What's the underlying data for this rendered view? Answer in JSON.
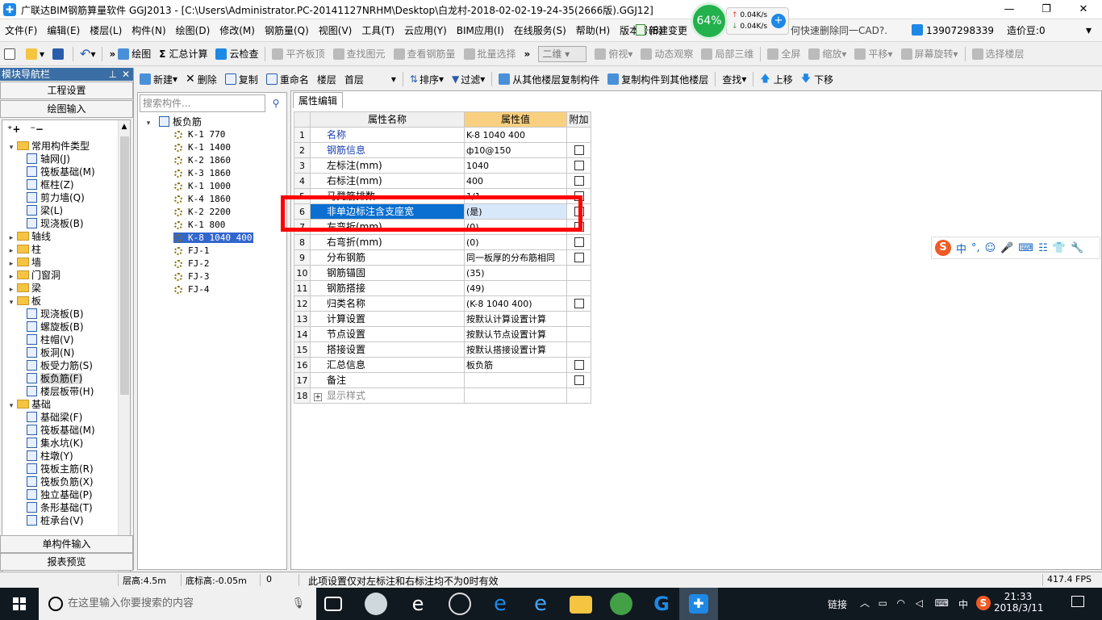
{
  "window": {
    "title": "广联达BIM钢筋算量软件 GGJ2013 - [C:\\Users\\Administrator.PC-20141127NRHM\\Desktop\\白龙村-2018-02-02-19-24-35(2666版).GGJ12]",
    "minimize": "—",
    "restore": "❐",
    "close": "✕"
  },
  "network": {
    "percent": "64%",
    "up": "0.04K/s",
    "down": "0.04K/s"
  },
  "menu": {
    "items": [
      "文件(F)",
      "编辑(E)",
      "楼层(L)",
      "构件(N)",
      "绘图(D)",
      "修改(M)",
      "钢筋量(Q)",
      "视图(V)",
      "工具(T)",
      "云应用(Y)",
      "BIM应用(I)",
      "在线服务(S)",
      "帮助(H)",
      "版本号(B)"
    ],
    "new_change": "新建变更",
    "tip": "何快速删除同一CAD?.",
    "phone": "13907298339",
    "cost_bean": "造价豆:0"
  },
  "toolbar": {
    "draw": "绘图",
    "sum_calc": "汇总计算",
    "cloud_check": "云检查",
    "flush_slab": "平齐板顶",
    "find_element": "查找图元",
    "view_rebar": "查看钢筋量",
    "batch_select": "批量选择",
    "view_mode": "二维",
    "top_view": "俯视",
    "dynamic_view": "动态观察",
    "local_3d": "局部三维",
    "fullscreen": "全屏",
    "zoom": "缩放",
    "pan": "平移",
    "rotate": "屏幕旋转",
    "select_floor": "选择楼层"
  },
  "toolbar2": {
    "new": "新建",
    "delete": "删除",
    "copy": "复制",
    "rename": "重命名",
    "floor_label": "楼层",
    "floor_value": "首层",
    "sort": "排序",
    "filter": "过滤",
    "copy_from": "从其他楼层复制构件",
    "copy_to": "复制构件到其他楼层",
    "find": "查找",
    "move_up": "上移",
    "move_down": "下移"
  },
  "nav": {
    "header": "模块导航栏",
    "project_settings": "工程设置",
    "drawing_input": "绘图输入",
    "single_input": "单构件输入",
    "report_preview": "报表预览",
    "tree": [
      {
        "level": 0,
        "exp": "▾",
        "folder": true,
        "label": "常用构件类型"
      },
      {
        "level": 1,
        "label": "轴网(J)"
      },
      {
        "level": 1,
        "label": "筏板基础(M)"
      },
      {
        "level": 1,
        "label": "框柱(Z)"
      },
      {
        "level": 1,
        "label": "剪力墙(Q)"
      },
      {
        "level": 1,
        "label": "梁(L)"
      },
      {
        "level": 1,
        "label": "现浇板(B)"
      },
      {
        "level": 0,
        "exp": "▸",
        "folder": true,
        "label": "轴线"
      },
      {
        "level": 0,
        "exp": "▸",
        "folder": true,
        "label": "柱"
      },
      {
        "level": 0,
        "exp": "▸",
        "folder": true,
        "label": "墙"
      },
      {
        "level": 0,
        "exp": "▸",
        "folder": true,
        "label": "门窗洞"
      },
      {
        "level": 0,
        "exp": "▸",
        "folder": true,
        "label": "梁"
      },
      {
        "level": 0,
        "exp": "▾",
        "folder": true,
        "label": "板"
      },
      {
        "level": 1,
        "label": "现浇板(B)"
      },
      {
        "level": 1,
        "label": "螺旋板(B)"
      },
      {
        "level": 1,
        "label": "柱帽(V)"
      },
      {
        "level": 1,
        "label": "板洞(N)"
      },
      {
        "level": 1,
        "label": "板受力筋(S)"
      },
      {
        "level": 1,
        "label": "板负筋(F)",
        "sel": true
      },
      {
        "level": 1,
        "label": "楼层板带(H)"
      },
      {
        "level": 0,
        "exp": "▾",
        "folder": true,
        "label": "基础"
      },
      {
        "level": 1,
        "label": "基础梁(F)"
      },
      {
        "level": 1,
        "label": "筏板基础(M)"
      },
      {
        "level": 1,
        "label": "集水坑(K)"
      },
      {
        "level": 1,
        "label": "柱墩(Y)"
      },
      {
        "level": 1,
        "label": "筏板主筋(R)"
      },
      {
        "level": 1,
        "label": "筏板负筋(X)"
      },
      {
        "level": 1,
        "label": "独立基础(P)"
      },
      {
        "level": 1,
        "label": "条形基础(T)"
      },
      {
        "level": 1,
        "label": "桩承台(V)"
      }
    ]
  },
  "components": {
    "search_placeholder": "搜索构件...",
    "root": "板负筋",
    "items": [
      {
        "label": "K-1 770"
      },
      {
        "label": "K-1 1400"
      },
      {
        "label": "K-2 1860"
      },
      {
        "label": "K-3 1860"
      },
      {
        "label": "K-1 1000"
      },
      {
        "label": "K-4 1860"
      },
      {
        "label": "K-2 2200"
      },
      {
        "label": "K-1 800"
      },
      {
        "label": "K-8 1040 400",
        "sel": true
      },
      {
        "label": "FJ-1"
      },
      {
        "label": "FJ-2"
      },
      {
        "label": "FJ-3"
      },
      {
        "label": "FJ-4"
      }
    ]
  },
  "props": {
    "tab": "属性编辑",
    "headers": {
      "name": "属性名称",
      "value": "属性值",
      "add": "附加"
    },
    "rows": [
      {
        "num": "1",
        "name": "名称",
        "value": "K-8 1040 400",
        "blue": true,
        "cb": false
      },
      {
        "num": "2",
        "name": "钢筋信息",
        "value": "ф10@150",
        "blue": true,
        "cb": true
      },
      {
        "num": "3",
        "name": "左标注(mm)",
        "value": "1040",
        "cb": true
      },
      {
        "num": "4",
        "name": "右标注(mm)",
        "value": "400",
        "cb": true
      },
      {
        "num": "5",
        "name": "马凳筋排数",
        "value": "1/1",
        "cb": true
      },
      {
        "num": "6",
        "name": "非单边标注含支座宽",
        "value": "(是)",
        "cb": true,
        "sel": true
      },
      {
        "num": "7",
        "name": "左弯折(mm)",
        "value": "(0)",
        "cb": true
      },
      {
        "num": "8",
        "name": "右弯折(mm)",
        "value": "(0)",
        "cb": true
      },
      {
        "num": "9",
        "name": "分布钢筋",
        "value": "同一板厚的分布筋相同",
        "cb": true
      },
      {
        "num": "10",
        "name": "钢筋锚固",
        "value": "(35)",
        "cb": false
      },
      {
        "num": "11",
        "name": "钢筋搭接",
        "value": "(49)",
        "cb": false
      },
      {
        "num": "12",
        "name": "归类名称",
        "value": "(K-8 1040 400)",
        "cb": true
      },
      {
        "num": "13",
        "name": "计算设置",
        "value": "按默认计算设置计算",
        "cb": false
      },
      {
        "num": "14",
        "name": "节点设置",
        "value": "按默认节点设置计算",
        "cb": false
      },
      {
        "num": "15",
        "name": "搭接设置",
        "value": "按默认搭接设置计算",
        "cb": false
      },
      {
        "num": "16",
        "name": "汇总信息",
        "value": "板负筋",
        "cb": true
      },
      {
        "num": "17",
        "name": "备注",
        "value": "",
        "cb": true
      },
      {
        "num": "18",
        "name": "显示样式",
        "value": "",
        "cb": false,
        "expander": true
      }
    ]
  },
  "ime": {
    "lang": "中",
    "punct": "°,"
  },
  "status": {
    "floor_height": "层高:4.5m",
    "bottom_height": "底标高:-0.05m",
    "zero": "0",
    "hint": "此项设置仅对左标注和右标注均不为0时有效",
    "fps": "417.4 FPS"
  },
  "taskbar": {
    "search_placeholder": "在这里输入你要搜索的内容",
    "link": "链接",
    "ime": "中",
    "time": "21:33",
    "date": "2018/3/11"
  }
}
